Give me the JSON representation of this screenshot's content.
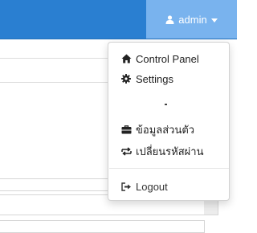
{
  "header": {
    "user_label": "admin",
    "user_icon": "user-icon",
    "caret_icon": "caret-down-icon"
  },
  "menu": {
    "items": [
      {
        "label": "Control Panel",
        "icon": "home-icon"
      },
      {
        "label": "Settings",
        "icon": "gear-icon"
      },
      {
        "label": "ข้อมูลส่วนตัว",
        "icon": "briefcase-icon"
      },
      {
        "label": "เปลี่ยนรหัสผ่าน",
        "icon": "exchange-icon"
      }
    ],
    "logout": {
      "label": "Logout",
      "icon": "sign-out-icon"
    }
  },
  "colors": {
    "topbar": "#2a7fd1",
    "user_button": "#79b3ee"
  }
}
